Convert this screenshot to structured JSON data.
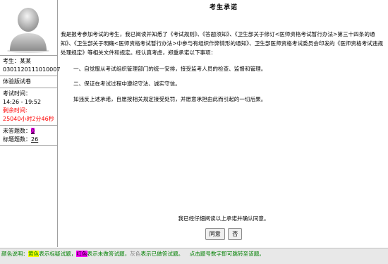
{
  "sidebar": {
    "candidate_label": "考生：某某",
    "candidate_id": "0301120111010007",
    "exam_type": "体验版试卷",
    "time_label": "考试时间：",
    "time_range": "14:26 - 19:52",
    "remaining_label": "剩余时间:",
    "remaining_value": "25040小时2分46秒",
    "unanswered_label": "未答题数：",
    "unanswered_count": "0",
    "marked_label": "标题题数：",
    "marked_count": "26"
  },
  "main": {
    "title": "考生承诺",
    "intro": "我是报考参加考试的考生，我已阅读并知悉了《考试规则》、《答题须知》、《卫生部关于修订<医师资格考试暂行办法>第三十四条的通知》、《卫生部关于明确<医师资格考试暂行办法>中参与有组织作弊情形的通知》、卫生部医师资格考试委员会印发的《医师资格考试违规处理规定》等相关文件和规定。经认真考虑，郑重承诺以下事项：",
    "item1": "一、自觉服从考试组织管理部门的统一安排，接受监考人员的检查、监督和管理。",
    "item2": "二、保证在考试过程中遵纪守法、诚实守信。",
    "item3": "如违反上述承诺，自愿按相关规定接受处罚，并愿意承担由此而引起的一切后果。",
    "confirm_text": "我已经仔细阅读以上承诺并确认同意。",
    "agree_button": "同意",
    "decline_button": "否"
  },
  "footer": {
    "prefix": "颜色说明：",
    "yellow_word": "黄色",
    "yellow_text": "表示标疑试题，",
    "magenta_word": "红色",
    "magenta_text": "表示未做答试题，",
    "gray_word": "灰色",
    "gray_text": "表示已做答试题。",
    "hint": "点击题号数字即可跳转至该题。"
  },
  "colors": {
    "remaining": "#ff0000",
    "unanswered_highlight": "#ff00ff",
    "footer_text": "#008000",
    "footer_bg": "#e8e8e8"
  }
}
